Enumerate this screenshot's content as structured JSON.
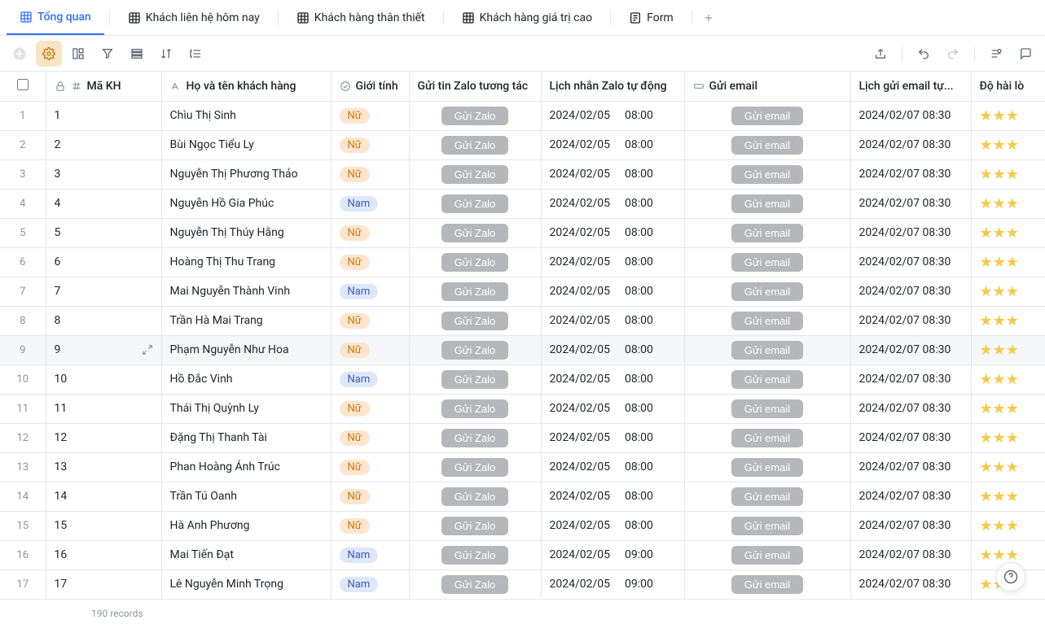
{
  "tabs": [
    {
      "label": "Tổng quan",
      "active": true
    },
    {
      "label": "Khách liên hệ hôm nay",
      "active": false
    },
    {
      "label": "Khách hàng thân thiết",
      "active": false
    },
    {
      "label": "Khách hàng giá trị cao",
      "active": false
    },
    {
      "label": "Form",
      "active": false,
      "form": true
    }
  ],
  "columns": {
    "makh": "Mã KH",
    "hoten": "Họ và tên khách hàng",
    "gioitinh": "Giới tính",
    "zalo": "Gửi tin Zalo tương tác",
    "lichzalo": "Lịch nhắn Zalo tự động",
    "email": "Gửi email",
    "lichemail": "Lịch gửi email tự...",
    "hailong": "Độ hài lò"
  },
  "buttons": {
    "zalo": "Gửi Zalo",
    "email": "Gửi email"
  },
  "gender_labels": {
    "Nữ": "Nữ",
    "Nam": "Nam"
  },
  "rows": [
    {
      "id": "1",
      "name": "Chìu Thị Sinh",
      "gender": "Nữ",
      "zalo_date": "2024/02/05",
      "zalo_time": "08:00",
      "email_date": "2024/02/07 08:30"
    },
    {
      "id": "2",
      "name": "Bùi Ngọc Tiểu Ly",
      "gender": "Nữ",
      "zalo_date": "2024/02/05",
      "zalo_time": "08:00",
      "email_date": "2024/02/07 08:30"
    },
    {
      "id": "3",
      "name": "Nguyễn Thị Phương Thảo",
      "gender": "Nữ",
      "zalo_date": "2024/02/05",
      "zalo_time": "08:00",
      "email_date": "2024/02/07 08:30"
    },
    {
      "id": "4",
      "name": "Nguyễn Hồ Gia Phúc",
      "gender": "Nam",
      "zalo_date": "2024/02/05",
      "zalo_time": "08:00",
      "email_date": "2024/02/07 08:30"
    },
    {
      "id": "5",
      "name": "Nguyễn Thị Thúy Hằng",
      "gender": "Nữ",
      "zalo_date": "2024/02/05",
      "zalo_time": "08:00",
      "email_date": "2024/02/07 08:30"
    },
    {
      "id": "6",
      "name": "Hoàng Thị Thu Trang",
      "gender": "Nữ",
      "zalo_date": "2024/02/05",
      "zalo_time": "08:00",
      "email_date": "2024/02/07 08:30"
    },
    {
      "id": "7",
      "name": "Mai Nguyễn Thành Vinh",
      "gender": "Nam",
      "zalo_date": "2024/02/05",
      "zalo_time": "08:00",
      "email_date": "2024/02/07 08:30"
    },
    {
      "id": "8",
      "name": "Trần Hà Mai Trang",
      "gender": "Nữ",
      "zalo_date": "2024/02/05",
      "zalo_time": "08:00",
      "email_date": "2024/02/07 08:30"
    },
    {
      "id": "9",
      "name": "Phạm Nguyễn Như Hoa",
      "gender": "Nữ",
      "zalo_date": "2024/02/05",
      "zalo_time": "08:00",
      "email_date": "2024/02/07 08:30",
      "hover": true
    },
    {
      "id": "10",
      "name": "Hồ Đắc Vinh",
      "gender": "Nam",
      "zalo_date": "2024/02/05",
      "zalo_time": "08:00",
      "email_date": "2024/02/07 08:30"
    },
    {
      "id": "11",
      "name": "Thái Thị Quỳnh Ly",
      "gender": "Nữ",
      "zalo_date": "2024/02/05",
      "zalo_time": "08:00",
      "email_date": "2024/02/07 08:30"
    },
    {
      "id": "12",
      "name": "Đặng Thị Thanh Tài",
      "gender": "Nữ",
      "zalo_date": "2024/02/05",
      "zalo_time": "08:00",
      "email_date": "2024/02/07 08:30"
    },
    {
      "id": "13",
      "name": "Phan Hoàng Ánh Trúc",
      "gender": "Nữ",
      "zalo_date": "2024/02/05",
      "zalo_time": "08:00",
      "email_date": "2024/02/07 08:30"
    },
    {
      "id": "14",
      "name": "Trần Tú Oanh",
      "gender": "Nữ",
      "zalo_date": "2024/02/05",
      "zalo_time": "08:00",
      "email_date": "2024/02/07 08:30"
    },
    {
      "id": "15",
      "name": "Hà Anh Phương",
      "gender": "Nữ",
      "zalo_date": "2024/02/05",
      "zalo_time": "08:00",
      "email_date": "2024/02/07 08:30"
    },
    {
      "id": "16",
      "name": "Mai Tiến Đạt",
      "gender": "Nam",
      "zalo_date": "2024/02/05",
      "zalo_time": "09:00",
      "email_date": "2024/02/07 08:30"
    },
    {
      "id": "17",
      "name": "Lê Nguyễn Minh Trọng",
      "gender": "Nam",
      "zalo_date": "2024/02/05",
      "zalo_time": "09:00",
      "email_date": "2024/02/07 08:30"
    }
  ],
  "footer": {
    "records": "190 records"
  }
}
